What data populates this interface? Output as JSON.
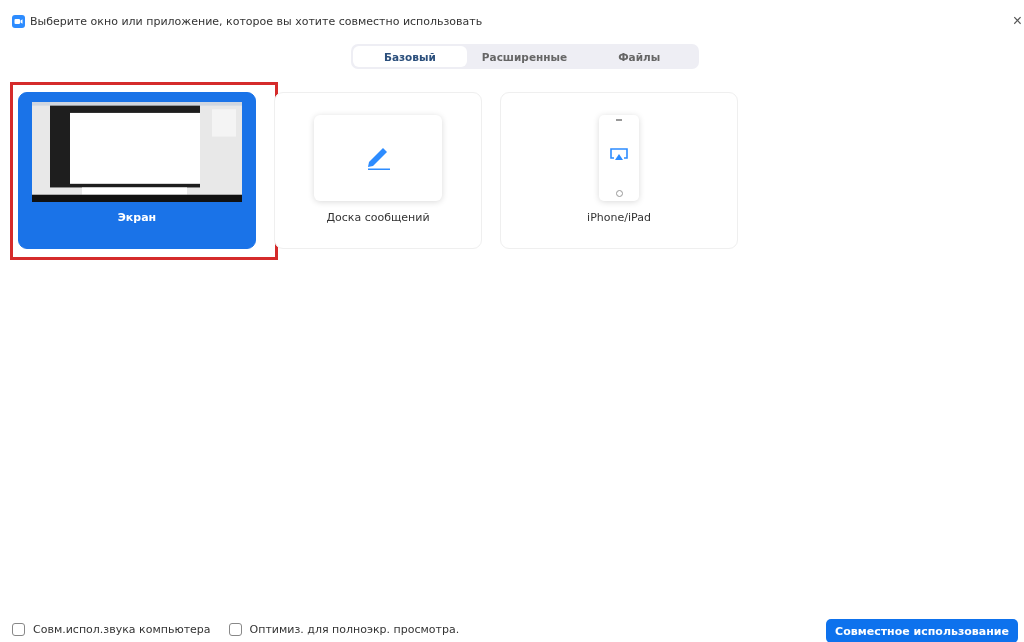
{
  "window": {
    "title": "Выберите окно или приложение, которое вы хотите совместно использовать",
    "close": "×"
  },
  "tabs": [
    {
      "label": "Базовый",
      "selected": true
    },
    {
      "label": "Расширенные",
      "selected": false
    },
    {
      "label": "Файлы",
      "selected": false
    }
  ],
  "tiles": [
    {
      "kind": "screen",
      "label": "Экран",
      "selected": true,
      "highlighted": true
    },
    {
      "kind": "whiteboard",
      "label": "Доска сообщений",
      "selected": false,
      "highlighted": false
    },
    {
      "kind": "device",
      "label": "iPhone/iPad",
      "selected": false,
      "highlighted": false
    }
  ],
  "options": [
    {
      "label": "Совм.испол.звука компьютера",
      "checked": false
    },
    {
      "label": "Оптимиз. для полноэкр. просмотра.",
      "checked": false
    }
  ],
  "share_button": "Совместное использование"
}
